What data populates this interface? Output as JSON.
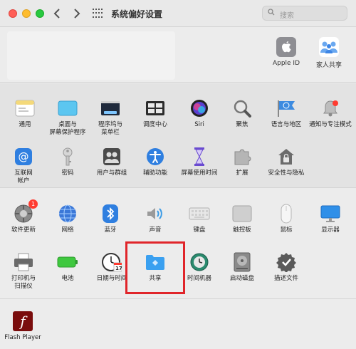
{
  "window": {
    "title": "系统偏好设置"
  },
  "search": {
    "placeholder": "搜索"
  },
  "account": {
    "items": [
      {
        "label": "Apple ID",
        "icon": "apple-logo-icon"
      },
      {
        "label": "家人共享",
        "icon": "family-sharing-icon"
      }
    ]
  },
  "section1": {
    "panes": [
      {
        "label": "通用",
        "icon": "general-icon"
      },
      {
        "label": "桌面与\n屏幕保护程序",
        "icon": "desktop-screensaver-icon"
      },
      {
        "label": "程序坞与\n菜单栏",
        "icon": "dock-menubar-icon"
      },
      {
        "label": "调度中心",
        "icon": "mission-control-icon"
      },
      {
        "label": "Siri",
        "icon": "siri-icon"
      },
      {
        "label": "聚焦",
        "icon": "spotlight-icon"
      },
      {
        "label": "语言与地区",
        "icon": "language-region-icon"
      },
      {
        "label": "通知与专注模式",
        "icon": "notifications-icon"
      },
      {
        "label": "互联网\n帐户",
        "icon": "internet-accounts-icon"
      },
      {
        "label": "密码",
        "icon": "passwords-icon"
      },
      {
        "label": "用户与群组",
        "icon": "users-groups-icon"
      },
      {
        "label": "辅助功能",
        "icon": "accessibility-icon"
      },
      {
        "label": "屏幕使用时间",
        "icon": "screen-time-icon"
      },
      {
        "label": "扩展",
        "icon": "extensions-icon"
      },
      {
        "label": "安全性与隐私",
        "icon": "security-privacy-icon"
      }
    ]
  },
  "section2": {
    "panes": [
      {
        "label": "软件更新",
        "icon": "software-update-icon",
        "badge": "1"
      },
      {
        "label": "网络",
        "icon": "network-icon"
      },
      {
        "label": "蓝牙",
        "icon": "bluetooth-icon"
      },
      {
        "label": "声音",
        "icon": "sound-icon"
      },
      {
        "label": "键盘",
        "icon": "keyboard-icon"
      },
      {
        "label": "触控板",
        "icon": "trackpad-icon"
      },
      {
        "label": "鼠标",
        "icon": "mouse-icon"
      },
      {
        "label": "显示器",
        "icon": "displays-icon"
      },
      {
        "label": "打印机与\n扫描仪",
        "icon": "printers-scanners-icon"
      },
      {
        "label": "电池",
        "icon": "battery-icon"
      },
      {
        "label": "日期与时间",
        "icon": "date-time-icon",
        "date": "17"
      },
      {
        "label": "共享",
        "icon": "sharing-icon"
      },
      {
        "label": "时间机器",
        "icon": "time-machine-icon"
      },
      {
        "label": "启动磁盘",
        "icon": "startup-disk-icon"
      },
      {
        "label": "描述文件",
        "icon": "profiles-icon"
      }
    ]
  },
  "section3": {
    "panes": [
      {
        "label": "Flash Player",
        "icon": "flash-player-icon",
        "glyph": "f"
      }
    ]
  },
  "colors": {
    "highlight": "#e0252a",
    "accent": "#2f7fe0"
  }
}
